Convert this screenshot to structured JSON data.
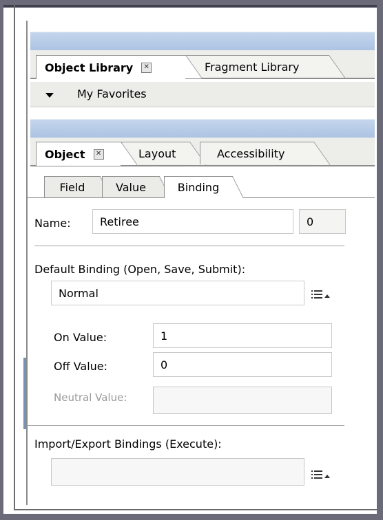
{
  "library_panel": {
    "tabs": [
      {
        "label": "Object Library",
        "active": true,
        "has_close": true
      },
      {
        "label": "Fragment Library",
        "active": false
      }
    ],
    "favorites_label": "My Favorites"
  },
  "object_panel": {
    "tabs": [
      {
        "label": "Object",
        "active": true,
        "has_close": true
      },
      {
        "label": "Layout",
        "active": false
      },
      {
        "label": "Accessibility",
        "active": false
      }
    ],
    "subtabs": [
      {
        "label": "Field",
        "active": false
      },
      {
        "label": "Value",
        "active": false
      },
      {
        "label": "Binding",
        "active": true
      }
    ],
    "name_label": "Name:",
    "name_value": "Retiree",
    "name_index": "0",
    "default_binding_label": "Default Binding (Open, Save, Submit):",
    "default_binding_value": "Normal",
    "on_value_label": "On Value:",
    "on_value": "1",
    "off_value_label": "Off Value:",
    "off_value": "0",
    "neutral_value_label": "Neutral Value:",
    "neutral_value": "",
    "import_export_label": "Import/Export Bindings (Execute):",
    "import_export_value": ""
  },
  "colors": {
    "titlebar": "#b8cce6",
    "tab_border": "#8d8d8d",
    "disabled_text": "#9a9a9a"
  },
  "icons": {
    "close": "close-box-icon",
    "dropdown": "triangle-down-icon",
    "list_menu": "list-menu-icon"
  }
}
